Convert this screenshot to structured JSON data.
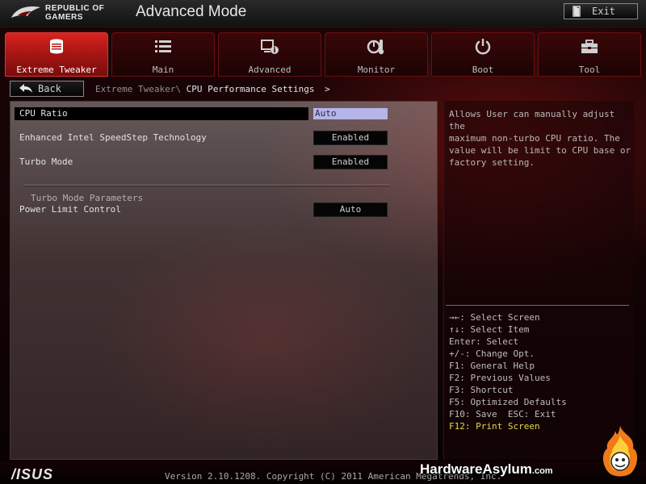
{
  "header": {
    "brand_text": "REPUBLIC OF\nGAMERS",
    "mode_title": "Advanced Mode",
    "exit_label": "Exit"
  },
  "tabs": [
    {
      "label": "Extreme Tweaker",
      "icon": "cpu-cooler-icon",
      "active": true
    },
    {
      "label": "Main",
      "icon": "list-icon",
      "active": false
    },
    {
      "label": "Advanced",
      "icon": "settings-info-icon",
      "active": false
    },
    {
      "label": "Monitor",
      "icon": "thermometer-icon",
      "active": false
    },
    {
      "label": "Boot",
      "icon": "power-icon",
      "active": false
    },
    {
      "label": "Tool",
      "icon": "toolbox-icon",
      "active": false
    }
  ],
  "nav": {
    "back_label": "Back",
    "breadcrumb_parent": "Extreme Tweaker\\",
    "breadcrumb_current": "CPU Performance Settings",
    "breadcrumb_arrow": ">"
  },
  "settings": {
    "items": [
      {
        "label": "CPU Ratio",
        "value": "Auto"
      },
      {
        "label": "Enhanced Intel SpeedStep Technology",
        "value": "Enabled"
      },
      {
        "label": "Turbo Mode",
        "value": "Enabled"
      }
    ],
    "section_title": "Turbo Mode Parameters",
    "power_limit": {
      "label": "Power Limit Control",
      "value": "Auto"
    }
  },
  "help": {
    "text": "Allows User can manually adjust the\nmaximum non-turbo CPU ratio. The\nvalue will be limit to CPU base or\nfactory setting.",
    "keys": [
      "→←: Select Screen",
      "↑↓: Select Item",
      "Enter: Select",
      "+/-: Change Opt.",
      "F1: General Help",
      "F2: Previous Values",
      "F3: Shortcut",
      "F5: Optimized Defaults",
      "F10: Save  ESC: Exit",
      "F12: Print Screen"
    ]
  },
  "footer": {
    "logo_text": "/ISUS",
    "version": "Version 2.10.1208. Copyright (C) 2011 American Megatrends, Inc.",
    "watermark_main": "HardwareAsylum",
    "watermark_suffix": ".com"
  },
  "colors": {
    "accent_red": "#d8231f",
    "selected_value_bg": "#b6b5ea",
    "highlight_key": "#e8d84a"
  }
}
